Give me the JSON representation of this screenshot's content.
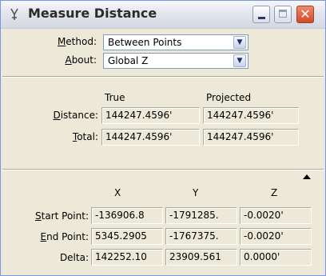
{
  "window": {
    "title": "Measure Distance",
    "title_icon": "measure-tool-icon",
    "buttons": {
      "minimize": "minimize-icon",
      "maximize": "maximize-icon",
      "close": "close-icon"
    }
  },
  "method": {
    "label_prefix": "",
    "label_accel": "M",
    "label_rest": "ethod:",
    "value": "Between Points"
  },
  "about": {
    "label_accel": "A",
    "label_rest": "bout:",
    "value": "Global Z"
  },
  "distance_section": {
    "headers": {
      "true": "True",
      "projected": "Projected"
    },
    "distance": {
      "label_accel": "D",
      "label_rest": "istance:",
      "true": "144247.4596'",
      "projected": "144247.4596'"
    },
    "total": {
      "label_accel": "T",
      "label_rest": "otal:",
      "true": "144247.4596'",
      "projected": "144247.4596'"
    }
  },
  "coords_section": {
    "headers": {
      "x": "X",
      "y": "Y",
      "z": "Z"
    },
    "start_point": {
      "label_accel": "S",
      "label_rest": "tart Point:",
      "x": "-136906.8",
      "y": "-1791285.",
      "z": "-0.0020'"
    },
    "end_point": {
      "label_accel": "E",
      "label_rest": "nd Point:",
      "x": "5345.2905",
      "y": "-1767375.",
      "z": "-0.0020'"
    },
    "delta": {
      "label": "Delta:",
      "x": "142252.10",
      "y": "23909.561",
      "z": "0.0000'"
    }
  },
  "colors": {
    "window_bg": "#ece9d8",
    "field_border": "#7f9db9",
    "close_button": "#d04a25"
  }
}
